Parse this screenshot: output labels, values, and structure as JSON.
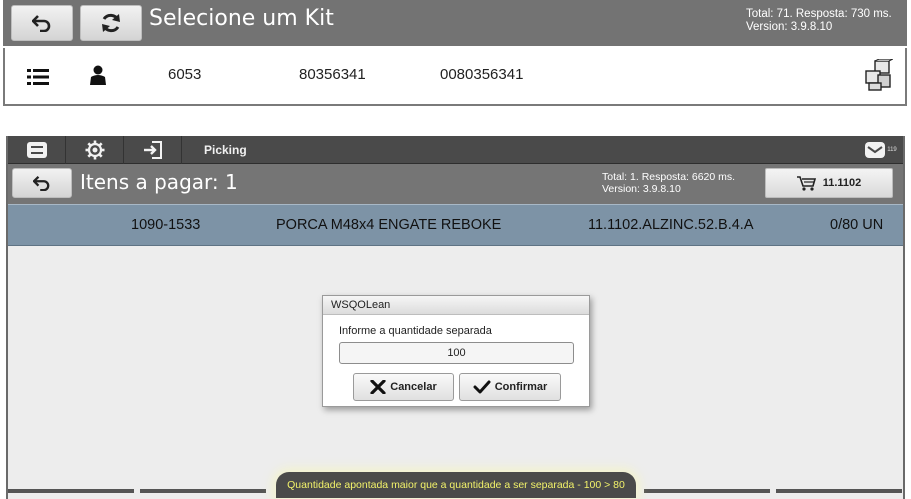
{
  "top": {
    "title": "Selecione um Kit",
    "status_line1": "Total: 71. Resposta: 730 ms.",
    "status_line2": "Version: 3.9.8.10",
    "row": {
      "col1": "6053",
      "col2": "80356341",
      "col3": "0080356341"
    }
  },
  "picking": {
    "toolbar": {
      "picking_label": "Picking",
      "mail_count": "119"
    },
    "header": {
      "title": "Itens a pagar: 1",
      "status_line1": "Total: 1. Resposta: 6620 ms.",
      "status_line2": "Version: 3.9.8.10",
      "cart_label": "11.1102"
    },
    "item": {
      "code": "1090-1533",
      "description": "PORCA M48x4 ENGATE REBOKE",
      "location": "11.1102.ALZINC.52.B.4.A",
      "quantity": "0/80 UN"
    }
  },
  "dialog": {
    "title": "WSQOLean",
    "label": "Informe a quantidade separada",
    "value": "100",
    "cancel_label": "Cancelar",
    "confirm_label": "Confirmar"
  },
  "toast": {
    "message": "Quantidade apontada maior que a quantidade a ser separada - 100 > 80"
  },
  "colors": {
    "header_gray": "#737373",
    "item_row_blue": "#7d93a6",
    "toast_text": "#f2f26a"
  }
}
